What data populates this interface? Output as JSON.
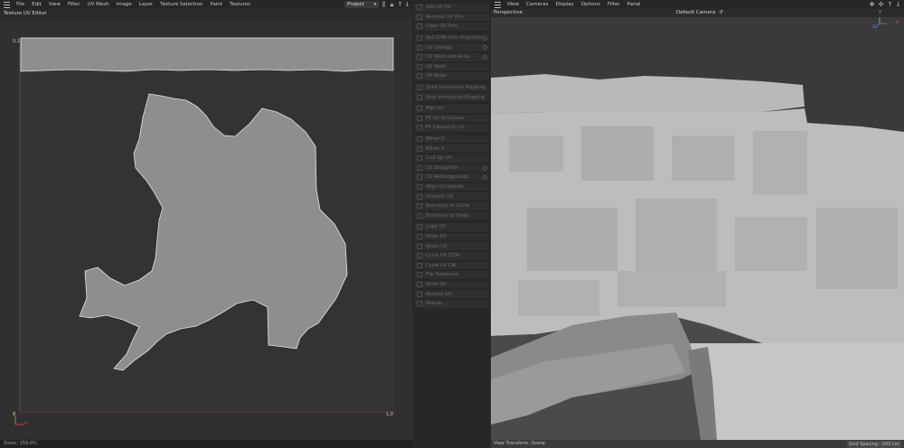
{
  "uv_editor": {
    "menu": [
      "File",
      "Edit",
      "View",
      "Filter",
      "UV Mesh",
      "Image",
      "Layer",
      "Texture Selection",
      "Paint",
      "Textures"
    ],
    "project_select": "Project",
    "title": "Texture UV Editor",
    "tick_top_left": "0,1",
    "tick_bottom_left": "0",
    "tick_bottom_right": "1,0",
    "axis_v": "V",
    "axis_u": "U",
    "zoom": "Zoom: 259.0%"
  },
  "commands": [
    {
      "label": "Add UV Pin",
      "gear": false
    },
    {
      "label": "Remove UV Pins",
      "gear": false
    },
    {
      "label": "Clear UV Pins",
      "gear": false
    },
    {
      "label": "Set UVW from Projection",
      "gear": true
    },
    {
      "label": "UV Unwrap",
      "gear": true
    },
    {
      "label": "UV Weld and Relax",
      "gear": true
    },
    {
      "label": "UV Weld",
      "gear": false
    },
    {
      "label": "UV Relax",
      "gear": false
    },
    {
      "label": "Start Interactive Mapping",
      "gear": false
    },
    {
      "label": "Stop Interactive Mapping",
      "gear": false
    },
    {
      "label": "Max UV",
      "gear": false
    },
    {
      "label": "Fit UV to Canvas",
      "gear": false
    },
    {
      "label": "Fit Canvas to UV",
      "gear": false
    },
    {
      "label": "Mirror U",
      "gear": false
    },
    {
      "label": "Mirror V",
      "gear": false
    },
    {
      "label": "Line Up UV",
      "gear": false
    },
    {
      "label": "UV Straighten",
      "gear": true
    },
    {
      "label": "UV Rectangularize",
      "gear": true
    },
    {
      "label": "Align UV Islands",
      "gear": false
    },
    {
      "label": "Unstitch UV",
      "gear": false
    },
    {
      "label": "Boundary to Circle",
      "gear": false
    },
    {
      "label": "Boundary to Quad",
      "gear": false
    },
    {
      "label": "Copy UV",
      "gear": false
    },
    {
      "label": "Paste UV",
      "gear": false
    },
    {
      "label": "Reset UV",
      "gear": false
    },
    {
      "label": "Cycle UV CCW",
      "gear": false
    },
    {
      "label": "Cycle UV CW",
      "gear": false
    },
    {
      "label": "Flip Sequence",
      "gear": false
    },
    {
      "label": "Store UV",
      "gear": false
    },
    {
      "label": "Restore UV",
      "gear": false
    },
    {
      "label": "Remap...",
      "gear": false
    }
  ],
  "viewport": {
    "menu": [
      "View",
      "Cameras",
      "Display",
      "Options",
      "Filter",
      "Panel"
    ],
    "label": "Perspective",
    "camera": "Default Camera",
    "axis_y": "Y",
    "axis_z": "Z",
    "axis_x": "X",
    "view_transform": "View Transform: Scene",
    "grid_spacing": "Grid Spacing : 500 cm"
  }
}
